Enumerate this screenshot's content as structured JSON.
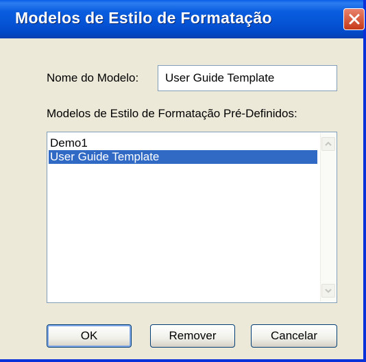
{
  "dialog": {
    "title": "Modelos de Estilo de Formatação",
    "close_icon": "close-icon",
    "name_label": "Nome do Modelo:",
    "name_value": "User Guide Template",
    "list_label": "Modelos de Estilo de Formatação Pré-Definidos:",
    "list_items": [
      {
        "label": "Demo1",
        "selected": false
      },
      {
        "label": "User Guide Template",
        "selected": true
      }
    ],
    "buttons": {
      "ok": "OK",
      "remove": "Remover",
      "cancel": "Cancelar"
    }
  },
  "colors": {
    "titlebar": "#0654d6",
    "selection": "#316ac5",
    "dialog_bg": "#ece9d8",
    "close_button": "#c63a19"
  }
}
